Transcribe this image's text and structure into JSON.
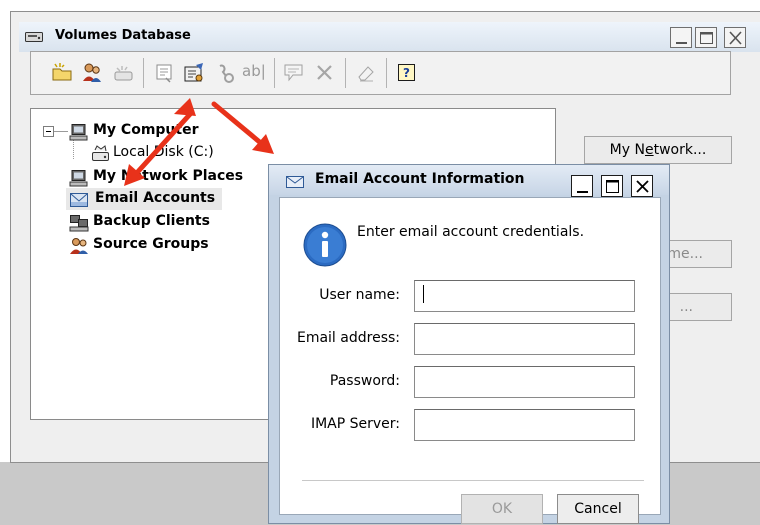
{
  "main_window": {
    "title": "Volumes Database",
    "toolbar": {
      "buttons": [
        {
          "icon": "new-folder-icon"
        },
        {
          "icon": "users-icon"
        },
        {
          "icon": "drive-icon"
        },
        {
          "icon": "properties-icon"
        },
        {
          "icon": "email-settings-icon"
        },
        {
          "icon": "link-icon"
        },
        {
          "icon": "rename-icon",
          "text": "ab|"
        },
        {
          "icon": "comment-icon"
        },
        {
          "icon": "delete-icon"
        },
        {
          "icon": "eraser-icon"
        },
        {
          "icon": "help-icon",
          "text": "?"
        }
      ]
    },
    "tree": {
      "items": [
        {
          "label": "My Computer",
          "icon": "computer-icon"
        },
        {
          "label": "Local Disk (C:)",
          "icon": "disk-icon"
        },
        {
          "label": "My Network Places",
          "icon": "network-icon"
        },
        {
          "label": "Email Accounts",
          "icon": "email-icon"
        },
        {
          "label": "Backup Clients",
          "icon": "backup-clients-icon"
        },
        {
          "label": "Source Groups",
          "icon": "source-groups-icon"
        }
      ]
    },
    "side_buttons": {
      "my_network": {
        "label": "My Network...",
        "underline_index": 4
      },
      "hidden_1": {
        "label": "me..."
      },
      "hidden_2": {
        "label": "..."
      }
    }
  },
  "dialog": {
    "title": "Email Account Information",
    "message": "Enter email account credentials.",
    "fields": [
      {
        "label": "User name:",
        "value": ""
      },
      {
        "label": "Email address:",
        "value": ""
      },
      {
        "label": "Password:",
        "value": ""
      },
      {
        "label": "IMAP Server:",
        "value": ""
      }
    ],
    "ok_label": "OK",
    "cancel_label": "Cancel"
  },
  "colors": {
    "annotation_arrow": "#e8321a",
    "dialog_frame": "#c4d3e4",
    "info_icon": "#2b6bc2"
  }
}
